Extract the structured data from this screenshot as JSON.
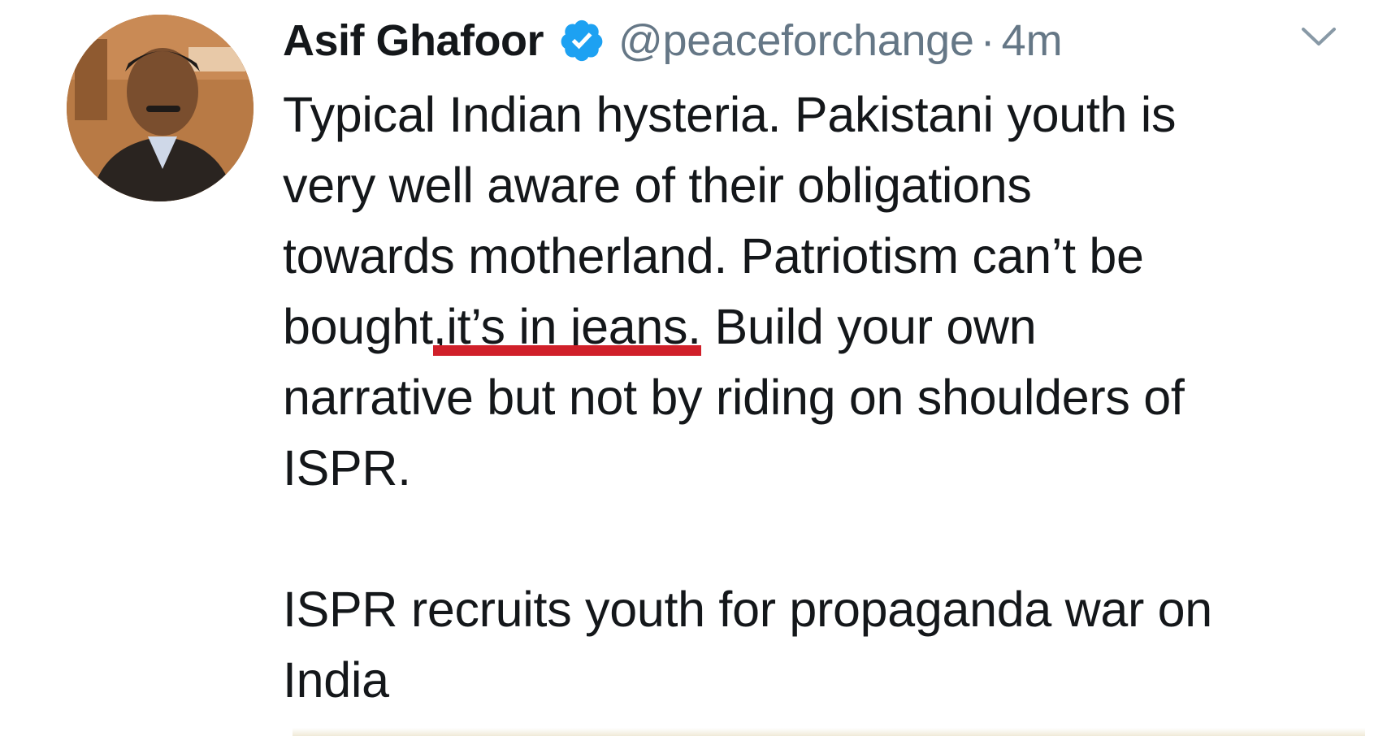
{
  "author": {
    "name": "Asif Ghafoor",
    "handle": "@peaceforchange",
    "separator": "·",
    "time": "4m",
    "verified": true
  },
  "tweet": {
    "line1": "Typical Indian hysteria. Pakistani youth is",
    "line2": "very well aware of their obligations",
    "line3": "towards motherland. Patriotism can’t be",
    "line4_before": "bought",
    "line4_highlight": ",it’s in jeans.",
    "line4_after": " Build your own",
    "line5": "narrative but not by riding on shoulders of",
    "line6": "ISPR.",
    "line7": "ISPR recruits youth for propaganda war on",
    "line8": "India"
  },
  "colors": {
    "text": "#14171a",
    "secondary": "#657786",
    "verified": "#1da1f2",
    "underline": "#d0202a"
  },
  "icons": {
    "verified": "verified-badge-icon",
    "menu": "chevron-down-icon"
  }
}
